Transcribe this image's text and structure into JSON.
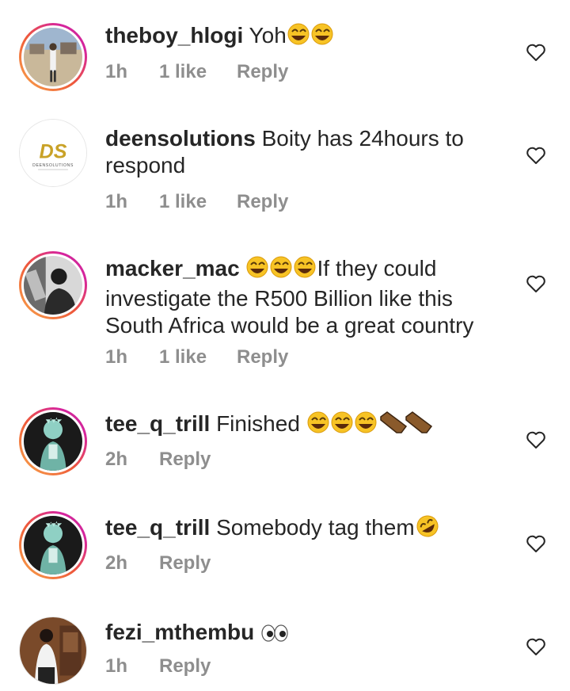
{
  "comments": [
    {
      "username": "theboy_hlogi",
      "text": "Yoh",
      "emoji_after": "laughing-tears-2",
      "time": "1h",
      "likes": "1 like",
      "reply": "Reply"
    },
    {
      "username": "deensolutions",
      "text": "Boity has 24hours to",
      "text2": "respond",
      "time": "1h",
      "likes": "1 like",
      "reply": "Reply",
      "avatar_logo": "DS",
      "avatar_logo_sub": "DEENSOLUTIONS"
    },
    {
      "username": "macker_mac",
      "text_line1": "If they could",
      "text_line2": "investigate the R500 Billion like this",
      "text_line3": "South Africa would be a great country",
      "time": "1h",
      "likes": "1 like",
      "reply": "Reply"
    },
    {
      "username": "tee_q_trill",
      "text": "Finished",
      "time": "2h",
      "reply": "Reply"
    },
    {
      "username": "tee_q_trill",
      "text": "Somebody tag them",
      "time": "2h",
      "reply": "Reply"
    },
    {
      "username": "fezi_mthembu",
      "time": "1h",
      "reply": "Reply"
    }
  ],
  "icons": {
    "like": "heart-outline-icon",
    "emoji_laugh": "face-with-tears-of-joy",
    "emoji_rofl": "rolling-on-floor-laughing",
    "emoji_coffin": "coffin",
    "emoji_eyes": "eyes"
  },
  "colors": {
    "username": "#262626",
    "meta": "#8e8e8e",
    "story_ring_start": "#f9a94b",
    "story_ring_end": "#c13584"
  }
}
